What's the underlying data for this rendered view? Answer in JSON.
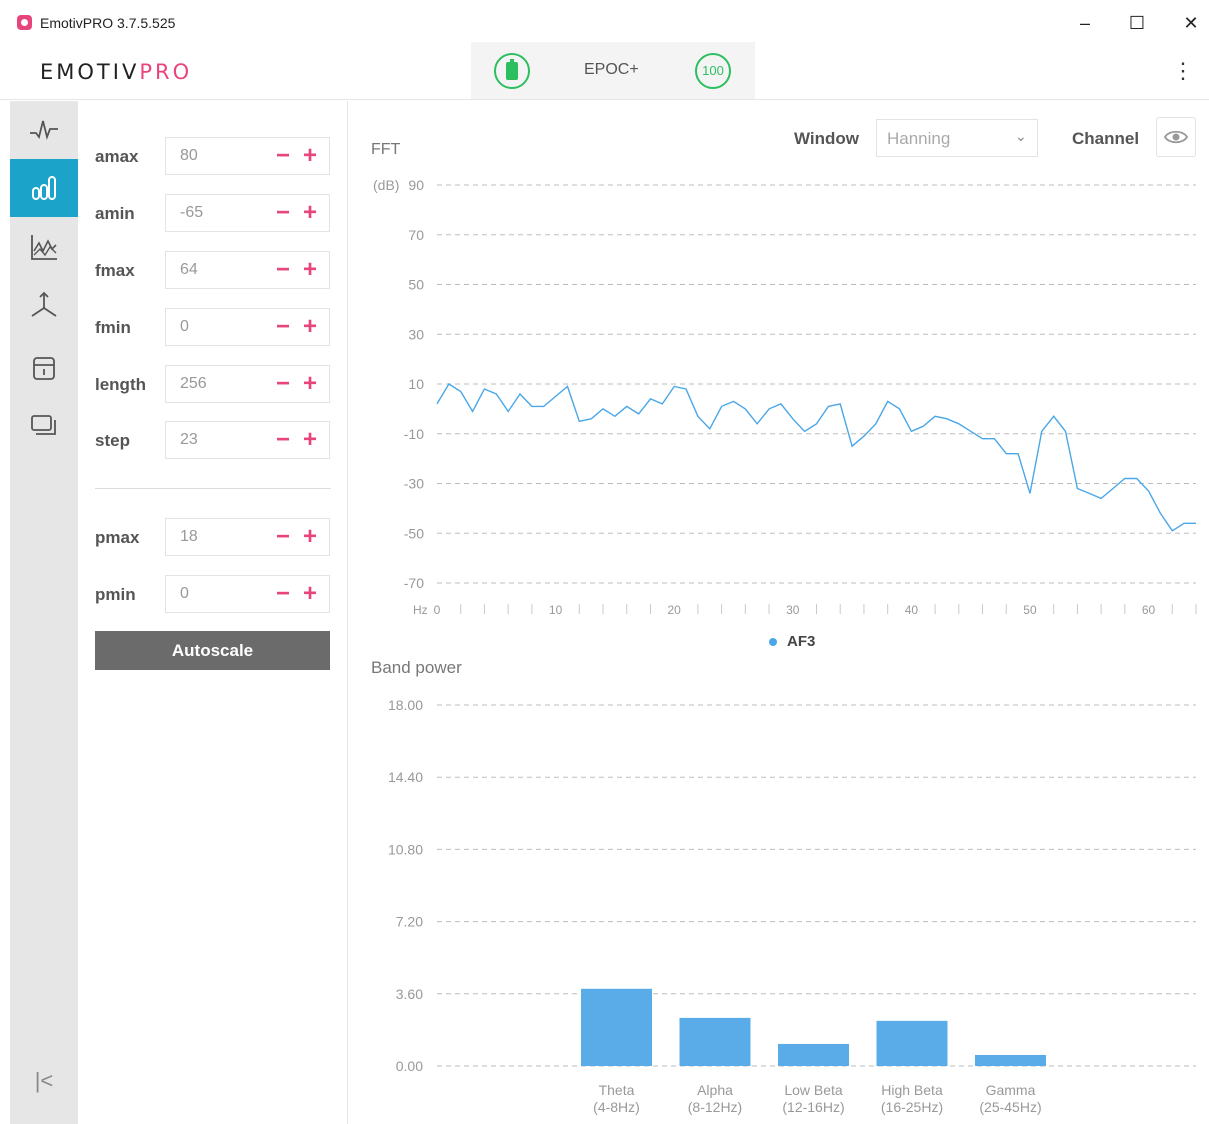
{
  "window": {
    "title": "EmotivPRO 3.7.5.525",
    "minimize": "–",
    "maximize": "☐",
    "close": "✕"
  },
  "header": {
    "logo_main": "EMOTIV",
    "logo_accent": "PRO",
    "device_name": "EPOC+",
    "signal_quality": "100",
    "menu_icon": "⋮",
    "accent_color": "#e8457c",
    "status_color": "#2dbf5f"
  },
  "nav": {
    "items": [
      {
        "name": "raw-data",
        "icon": "waveform-icon"
      },
      {
        "name": "fft-band-power",
        "icon": "bar-chart-icon",
        "active": true
      },
      {
        "name": "performance-metrics",
        "icon": "line-chart-icon"
      },
      {
        "name": "motion",
        "icon": "axes-icon"
      },
      {
        "name": "markers",
        "icon": "archive-icon"
      },
      {
        "name": "recordings",
        "icon": "screens-icon"
      }
    ],
    "collapse": "|<",
    "active_color": "#1ba3c9"
  },
  "settings": {
    "params": [
      {
        "label": "amax",
        "value": "80"
      },
      {
        "label": "amin",
        "value": "-65"
      },
      {
        "label": "fmax",
        "value": "64"
      },
      {
        "label": "fmin",
        "value": "0"
      },
      {
        "label": "length",
        "value": "256"
      },
      {
        "label": "step",
        "value": "23"
      },
      {
        "label": "pmax",
        "value": "18"
      },
      {
        "label": "pmin",
        "value": "0"
      }
    ],
    "minus": "−",
    "plus": "+",
    "autoscale_label": "Autoscale"
  },
  "controls": {
    "window_label": "Window",
    "window_value": "Hanning",
    "channel_label": "Channel"
  },
  "chart_data": [
    {
      "type": "line",
      "title": "FFT",
      "ylabel": "(dB)",
      "xlabel": "Hz",
      "ylim": [
        -70,
        90
      ],
      "yticks": [
        90,
        70,
        50,
        30,
        10,
        -10,
        -30,
        -50,
        -70
      ],
      "xlim": [
        0,
        64
      ],
      "xticks": [
        0,
        10,
        20,
        30,
        40,
        50,
        60
      ],
      "grid": true,
      "legend": "bottom-center",
      "series": [
        {
          "name": "AF3",
          "color": "#4aa7e8",
          "x": [
            0,
            1,
            2,
            3,
            4,
            5,
            6,
            7,
            8,
            9,
            10,
            11,
            12,
            13,
            14,
            15,
            16,
            17,
            18,
            19,
            20,
            21,
            22,
            23,
            24,
            25,
            26,
            27,
            28,
            29,
            30,
            31,
            32,
            33,
            34,
            35,
            36,
            37,
            38,
            39,
            40,
            41,
            42,
            43,
            44,
            45,
            46,
            47,
            48,
            49,
            50,
            51,
            52,
            53,
            54,
            55,
            56,
            57,
            58,
            59,
            60,
            61,
            62,
            63,
            64
          ],
          "y": [
            2,
            10,
            7,
            -1,
            8,
            6,
            -1,
            6,
            1,
            1,
            5,
            9,
            -5,
            -4,
            0,
            -3,
            1,
            -2,
            4,
            2,
            9,
            8,
            -3,
            -8,
            1,
            3,
            0,
            -6,
            0,
            2,
            -4,
            -9,
            -6,
            1,
            2,
            -15,
            -11,
            -6,
            3,
            0,
            -9,
            -7,
            -3,
            -4,
            -6,
            -9,
            -12,
            -12,
            -18,
            -18,
            -34,
            -9,
            -3,
            -9,
            -32,
            -34,
            -36,
            -32,
            -28,
            -28,
            -33,
            -42,
            -49,
            -46,
            -46
          ]
        }
      ]
    },
    {
      "type": "bar",
      "title": "Band power",
      "ylim": [
        0,
        18
      ],
      "yticks": [
        "18.00",
        "14.40",
        "10.80",
        "7.20",
        "3.60",
        "0.00"
      ],
      "grid": true,
      "categories": [
        "Theta (4-8Hz)",
        "Alpha (8-12Hz)",
        "Low Beta (12-16Hz)",
        "High Beta (16-25Hz)",
        "Gamma (25-45Hz)"
      ],
      "category_lines": [
        [
          "Theta",
          "(4-8Hz)"
        ],
        [
          "Alpha",
          "(8-12Hz)"
        ],
        [
          "Low Beta",
          "(12-16Hz)"
        ],
        [
          "High Beta",
          "(16-25Hz)"
        ],
        [
          "Gamma",
          "(25-45Hz)"
        ]
      ],
      "values": [
        3.85,
        2.4,
        1.1,
        2.25,
        0.55
      ],
      "color": "#5aace9"
    }
  ]
}
